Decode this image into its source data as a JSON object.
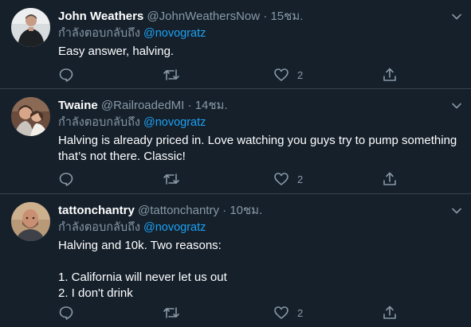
{
  "colors": {
    "background": "#15202b",
    "divider": "#38444d",
    "secondary_text": "#8899a6",
    "link": "#1da1f2",
    "primary_text": "#ffffff"
  },
  "tweets": [
    {
      "name": "John Weathers",
      "handle": "@JohnWeathersNow",
      "dot": "·",
      "time": "15ชม.",
      "reply_prefix": "กำลังตอบกลับถึง",
      "reply_mention": "@novogratz",
      "text": "Easy answer, halving.",
      "like_count": "2",
      "avatar_icon": "avatar-man-dark-coat"
    },
    {
      "name": "Twaine",
      "handle": "@RailroadedMI",
      "dot": "·",
      "time": "14ชม.",
      "reply_prefix": "กำลังตอบกลับถึง",
      "reply_mention": "@novogratz",
      "text": "Halving is already priced in. Love watching you guys try to pump something that’s not there. Classic!",
      "like_count": "2",
      "avatar_icon": "avatar-couple-photo"
    },
    {
      "name": "tattonchantry",
      "handle": "@tattonchantry",
      "dot": "·",
      "time": "10ชม.",
      "reply_prefix": "กำลังตอบกลับถึง",
      "reply_mention": "@novogratz",
      "text": "Halving and 10k. Two reasons:\n\n1. California will never let us out\n2. I don't drink",
      "like_count": "2",
      "avatar_icon": "avatar-man-bald"
    }
  ]
}
